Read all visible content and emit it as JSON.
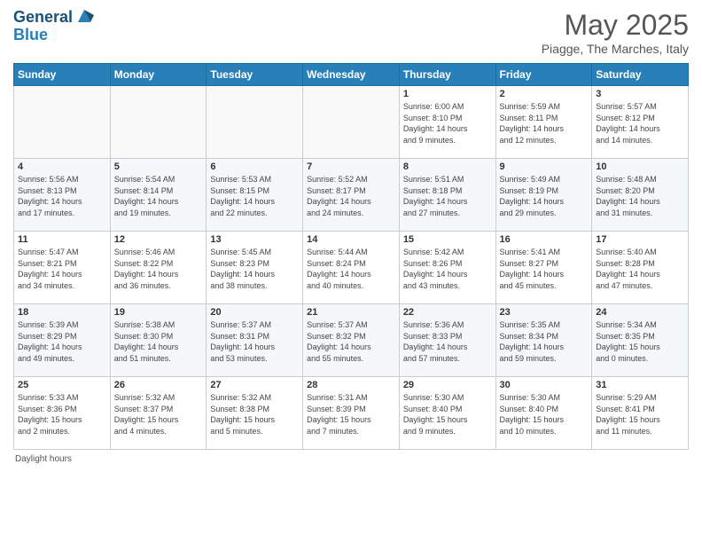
{
  "header": {
    "logo_line1": "General",
    "logo_line2": "Blue",
    "month_title": "May 2025",
    "location": "Piagge, The Marches, Italy"
  },
  "days_of_week": [
    "Sunday",
    "Monday",
    "Tuesday",
    "Wednesday",
    "Thursday",
    "Friday",
    "Saturday"
  ],
  "weeks": [
    [
      {
        "day": "",
        "info": ""
      },
      {
        "day": "",
        "info": ""
      },
      {
        "day": "",
        "info": ""
      },
      {
        "day": "",
        "info": ""
      },
      {
        "day": "1",
        "info": "Sunrise: 6:00 AM\nSunset: 8:10 PM\nDaylight: 14 hours\nand 9 minutes."
      },
      {
        "day": "2",
        "info": "Sunrise: 5:59 AM\nSunset: 8:11 PM\nDaylight: 14 hours\nand 12 minutes."
      },
      {
        "day": "3",
        "info": "Sunrise: 5:57 AM\nSunset: 8:12 PM\nDaylight: 14 hours\nand 14 minutes."
      }
    ],
    [
      {
        "day": "4",
        "info": "Sunrise: 5:56 AM\nSunset: 8:13 PM\nDaylight: 14 hours\nand 17 minutes."
      },
      {
        "day": "5",
        "info": "Sunrise: 5:54 AM\nSunset: 8:14 PM\nDaylight: 14 hours\nand 19 minutes."
      },
      {
        "day": "6",
        "info": "Sunrise: 5:53 AM\nSunset: 8:15 PM\nDaylight: 14 hours\nand 22 minutes."
      },
      {
        "day": "7",
        "info": "Sunrise: 5:52 AM\nSunset: 8:17 PM\nDaylight: 14 hours\nand 24 minutes."
      },
      {
        "day": "8",
        "info": "Sunrise: 5:51 AM\nSunset: 8:18 PM\nDaylight: 14 hours\nand 27 minutes."
      },
      {
        "day": "9",
        "info": "Sunrise: 5:49 AM\nSunset: 8:19 PM\nDaylight: 14 hours\nand 29 minutes."
      },
      {
        "day": "10",
        "info": "Sunrise: 5:48 AM\nSunset: 8:20 PM\nDaylight: 14 hours\nand 31 minutes."
      }
    ],
    [
      {
        "day": "11",
        "info": "Sunrise: 5:47 AM\nSunset: 8:21 PM\nDaylight: 14 hours\nand 34 minutes."
      },
      {
        "day": "12",
        "info": "Sunrise: 5:46 AM\nSunset: 8:22 PM\nDaylight: 14 hours\nand 36 minutes."
      },
      {
        "day": "13",
        "info": "Sunrise: 5:45 AM\nSunset: 8:23 PM\nDaylight: 14 hours\nand 38 minutes."
      },
      {
        "day": "14",
        "info": "Sunrise: 5:44 AM\nSunset: 8:24 PM\nDaylight: 14 hours\nand 40 minutes."
      },
      {
        "day": "15",
        "info": "Sunrise: 5:42 AM\nSunset: 8:26 PM\nDaylight: 14 hours\nand 43 minutes."
      },
      {
        "day": "16",
        "info": "Sunrise: 5:41 AM\nSunset: 8:27 PM\nDaylight: 14 hours\nand 45 minutes."
      },
      {
        "day": "17",
        "info": "Sunrise: 5:40 AM\nSunset: 8:28 PM\nDaylight: 14 hours\nand 47 minutes."
      }
    ],
    [
      {
        "day": "18",
        "info": "Sunrise: 5:39 AM\nSunset: 8:29 PM\nDaylight: 14 hours\nand 49 minutes."
      },
      {
        "day": "19",
        "info": "Sunrise: 5:38 AM\nSunset: 8:30 PM\nDaylight: 14 hours\nand 51 minutes."
      },
      {
        "day": "20",
        "info": "Sunrise: 5:37 AM\nSunset: 8:31 PM\nDaylight: 14 hours\nand 53 minutes."
      },
      {
        "day": "21",
        "info": "Sunrise: 5:37 AM\nSunset: 8:32 PM\nDaylight: 14 hours\nand 55 minutes."
      },
      {
        "day": "22",
        "info": "Sunrise: 5:36 AM\nSunset: 8:33 PM\nDaylight: 14 hours\nand 57 minutes."
      },
      {
        "day": "23",
        "info": "Sunrise: 5:35 AM\nSunset: 8:34 PM\nDaylight: 14 hours\nand 59 minutes."
      },
      {
        "day": "24",
        "info": "Sunrise: 5:34 AM\nSunset: 8:35 PM\nDaylight: 15 hours\nand 0 minutes."
      }
    ],
    [
      {
        "day": "25",
        "info": "Sunrise: 5:33 AM\nSunset: 8:36 PM\nDaylight: 15 hours\nand 2 minutes."
      },
      {
        "day": "26",
        "info": "Sunrise: 5:32 AM\nSunset: 8:37 PM\nDaylight: 15 hours\nand 4 minutes."
      },
      {
        "day": "27",
        "info": "Sunrise: 5:32 AM\nSunset: 8:38 PM\nDaylight: 15 hours\nand 5 minutes."
      },
      {
        "day": "28",
        "info": "Sunrise: 5:31 AM\nSunset: 8:39 PM\nDaylight: 15 hours\nand 7 minutes."
      },
      {
        "day": "29",
        "info": "Sunrise: 5:30 AM\nSunset: 8:40 PM\nDaylight: 15 hours\nand 9 minutes."
      },
      {
        "day": "30",
        "info": "Sunrise: 5:30 AM\nSunset: 8:40 PM\nDaylight: 15 hours\nand 10 minutes."
      },
      {
        "day": "31",
        "info": "Sunrise: 5:29 AM\nSunset: 8:41 PM\nDaylight: 15 hours\nand 11 minutes."
      }
    ]
  ],
  "footer": {
    "daylight_label": "Daylight hours"
  }
}
